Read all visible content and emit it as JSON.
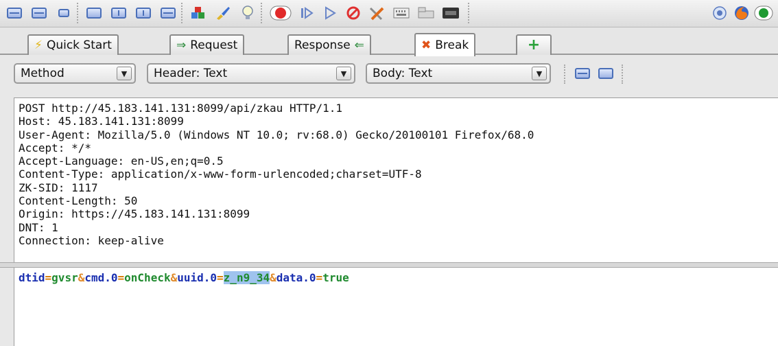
{
  "toolbar": {
    "icons": [
      "view-top-bottom-icon",
      "view-stacked-icon",
      "view-single-icon",
      "window-maximize-icon",
      "window-left-right-icon",
      "window-right-left-icon",
      "window-full-icon",
      "blocks-icon",
      "paint-brush-icon",
      "lightbulb-icon",
      "break-request-icon",
      "step-icon",
      "continue-icon",
      "drop-icon",
      "tools-icon",
      "keyboard-icon",
      "grid-icon",
      "terminal-icon",
      "globe-icon",
      "firefox-icon",
      "record-icon"
    ]
  },
  "tabs": [
    {
      "label": "Quick Start",
      "icon": "lightning-icon"
    },
    {
      "label": "Request",
      "icon": "arrow-right-icon"
    },
    {
      "label": "Response",
      "icon": "arrow-left-icon"
    },
    {
      "label": "Break",
      "icon": "cross-icon"
    },
    {
      "label": "",
      "icon": "add-tab-icon"
    }
  ],
  "selectors": {
    "method": "Method",
    "header": "Header: Text",
    "body": "Body: Text"
  },
  "request_headers": [
    "POST http://45.183.141.131:8099/api/zkau HTTP/1.1",
    "Host: 45.183.141.131:8099",
    "User-Agent: Mozilla/5.0 (Windows NT 10.0; rv:68.0) Gecko/20100101 Firefox/68.0",
    "Accept: */*",
    "Accept-Language: en-US,en;q=0.5",
    "Content-Type: application/x-www-form-urlencoded;charset=UTF-8",
    "ZK-SID: 1117",
    "Content-Length: 50",
    "Origin: https://45.183.141.131:8099",
    "DNT: 1",
    "Connection: keep-alive"
  ],
  "request_body": {
    "dtid_key": "dtid",
    "eq1": "=",
    "dtid_val": "gvsr",
    "amp1": "&",
    "cmd_key": "cmd.0",
    "eq2": "=",
    "cmd_val": "onCheck",
    "amp2": "&",
    "uuid_key": "uuid.0",
    "eq3": "=",
    "uuid_val": "z_n9_34",
    "amp3": "&",
    "data_key": "data.0",
    "eq4": "=",
    "data_val": "true"
  },
  "colors": {
    "key": "#1a2fb0",
    "value": "#1f8a2e",
    "operator": "#d97a00",
    "selection": "#9fc3ee"
  }
}
